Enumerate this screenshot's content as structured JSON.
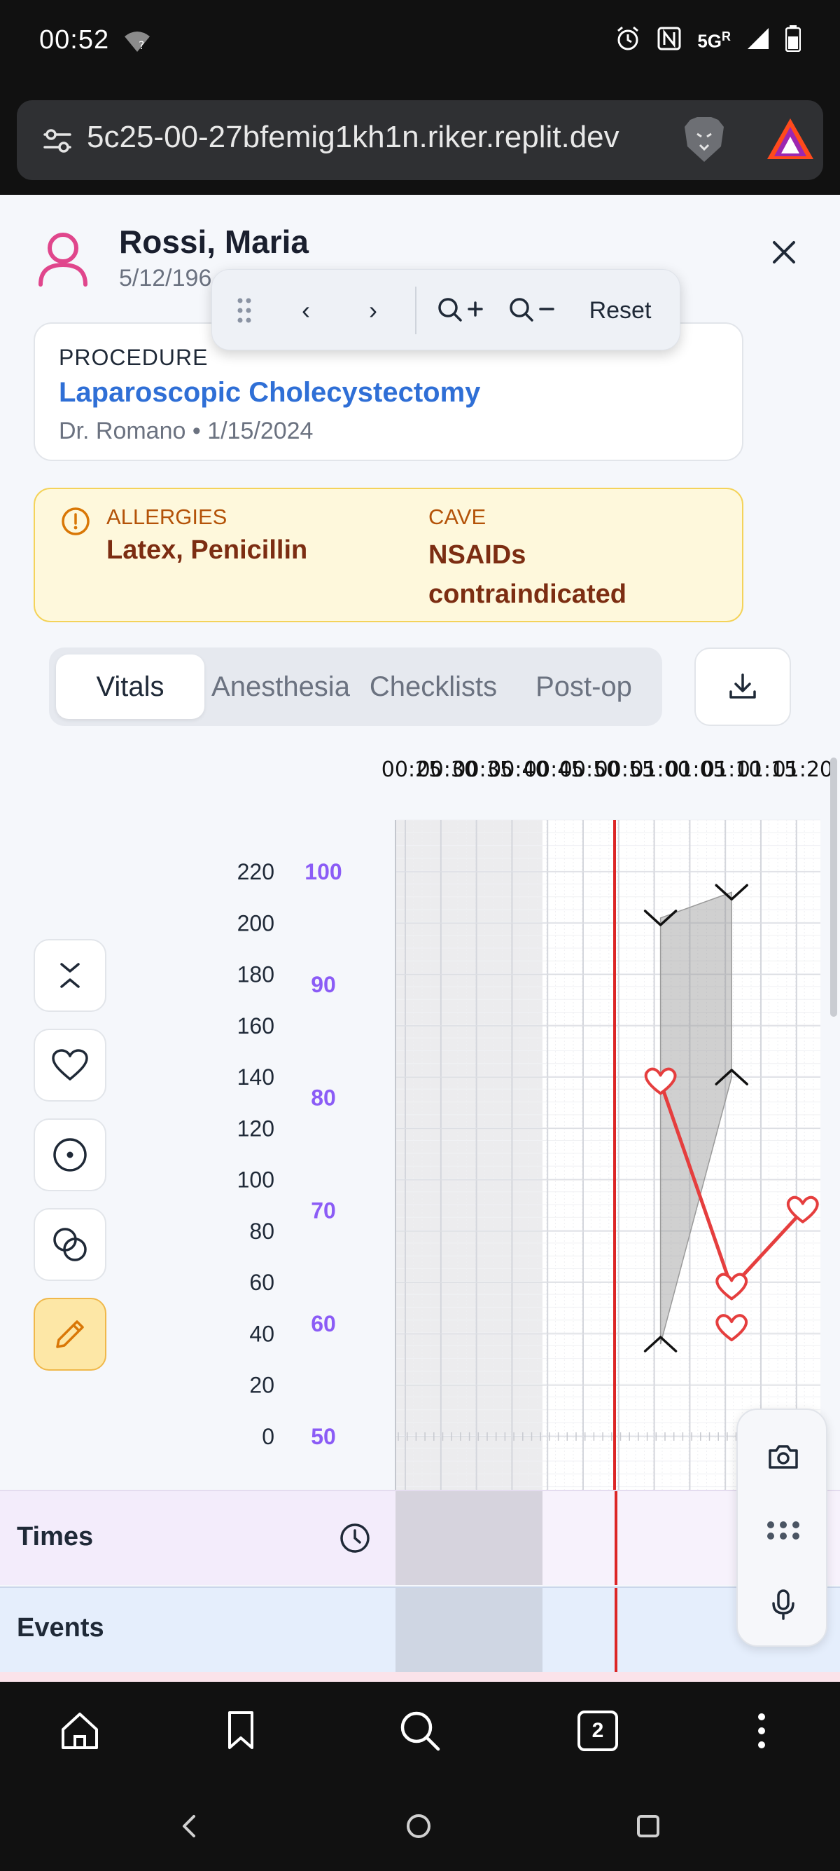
{
  "status_bar": {
    "time": "00:52",
    "network": "5G",
    "network_sup": "R"
  },
  "browser": {
    "url": "5c25-00-27bfemig1kh1n.riker.replit.dev"
  },
  "patient": {
    "name": "Rossi, Maria",
    "dob": "5/12/196"
  },
  "nav_toolbar": {
    "prev": "‹",
    "next": "›",
    "zoom_in": "Q+",
    "zoom_out": "Q−",
    "reset": "Reset"
  },
  "procedure": {
    "label": "PROCEDURE",
    "title": "Laparoscopic Cholecystectomy",
    "meta": "Dr. Romano • 1/15/2024"
  },
  "alerts": {
    "allergies_label": "ALLERGIES",
    "allergies_value": "Latex, Penicillin",
    "cave_label": "CAVE",
    "cave_value": "NSAIDs contraindicated",
    "accent": "#b45309"
  },
  "tabs": [
    "Vitals",
    "Anesthesia",
    "Checklists",
    "Post-op"
  ],
  "active_tab": "Vitals",
  "side_tools": [
    "chevrons-icon",
    "heart-icon",
    "target-icon",
    "circles-icon",
    "pencil-icon"
  ],
  "rows": {
    "times": "Times",
    "events": "Events"
  },
  "browser_nav": {
    "tab_count": "2"
  },
  "chart_data": {
    "type": "line",
    "x_ticks": [
      "00:25",
      "00:30",
      "00:35",
      "00:40",
      "00:45",
      "00:50",
      "00:55",
      "01:00",
      "01:05",
      "01:10",
      "01:15",
      "01:20"
    ],
    "y_left_ticks": [
      220,
      200,
      180,
      160,
      140,
      120,
      100,
      80,
      60,
      40,
      20,
      0
    ],
    "y_right_ticks": [
      100,
      90,
      80,
      70,
      60,
      50
    ],
    "ylim_left": [
      0,
      220
    ],
    "ylim_right": [
      50,
      100
    ],
    "current_time": "00:52",
    "shaded_until": "00:45",
    "series": [
      {
        "name": "",
        "marker": "v",
        "points": [
          {
            "x": "01:00",
            "y": 202
          },
          {
            "x": "01:10",
            "y": 212
          }
        ]
      },
      {
        "name": "",
        "marker": "^",
        "points": [
          {
            "x": "01:00",
            "y": 36
          },
          {
            "x": "01:10",
            "y": 140
          }
        ]
      },
      {
        "name": "",
        "marker": "heart",
        "color": "#e53e3e",
        "points": [
          {
            "x": "01:00",
            "y": 138
          },
          {
            "x": "01:10",
            "y": 58
          },
          {
            "x": "01:20",
            "y": 88
          }
        ]
      },
      {
        "name": "",
        "marker": "heart-outline",
        "color": "#e53e3e",
        "points": [
          {
            "x": "01:10",
            "y": 42
          }
        ]
      }
    ]
  }
}
